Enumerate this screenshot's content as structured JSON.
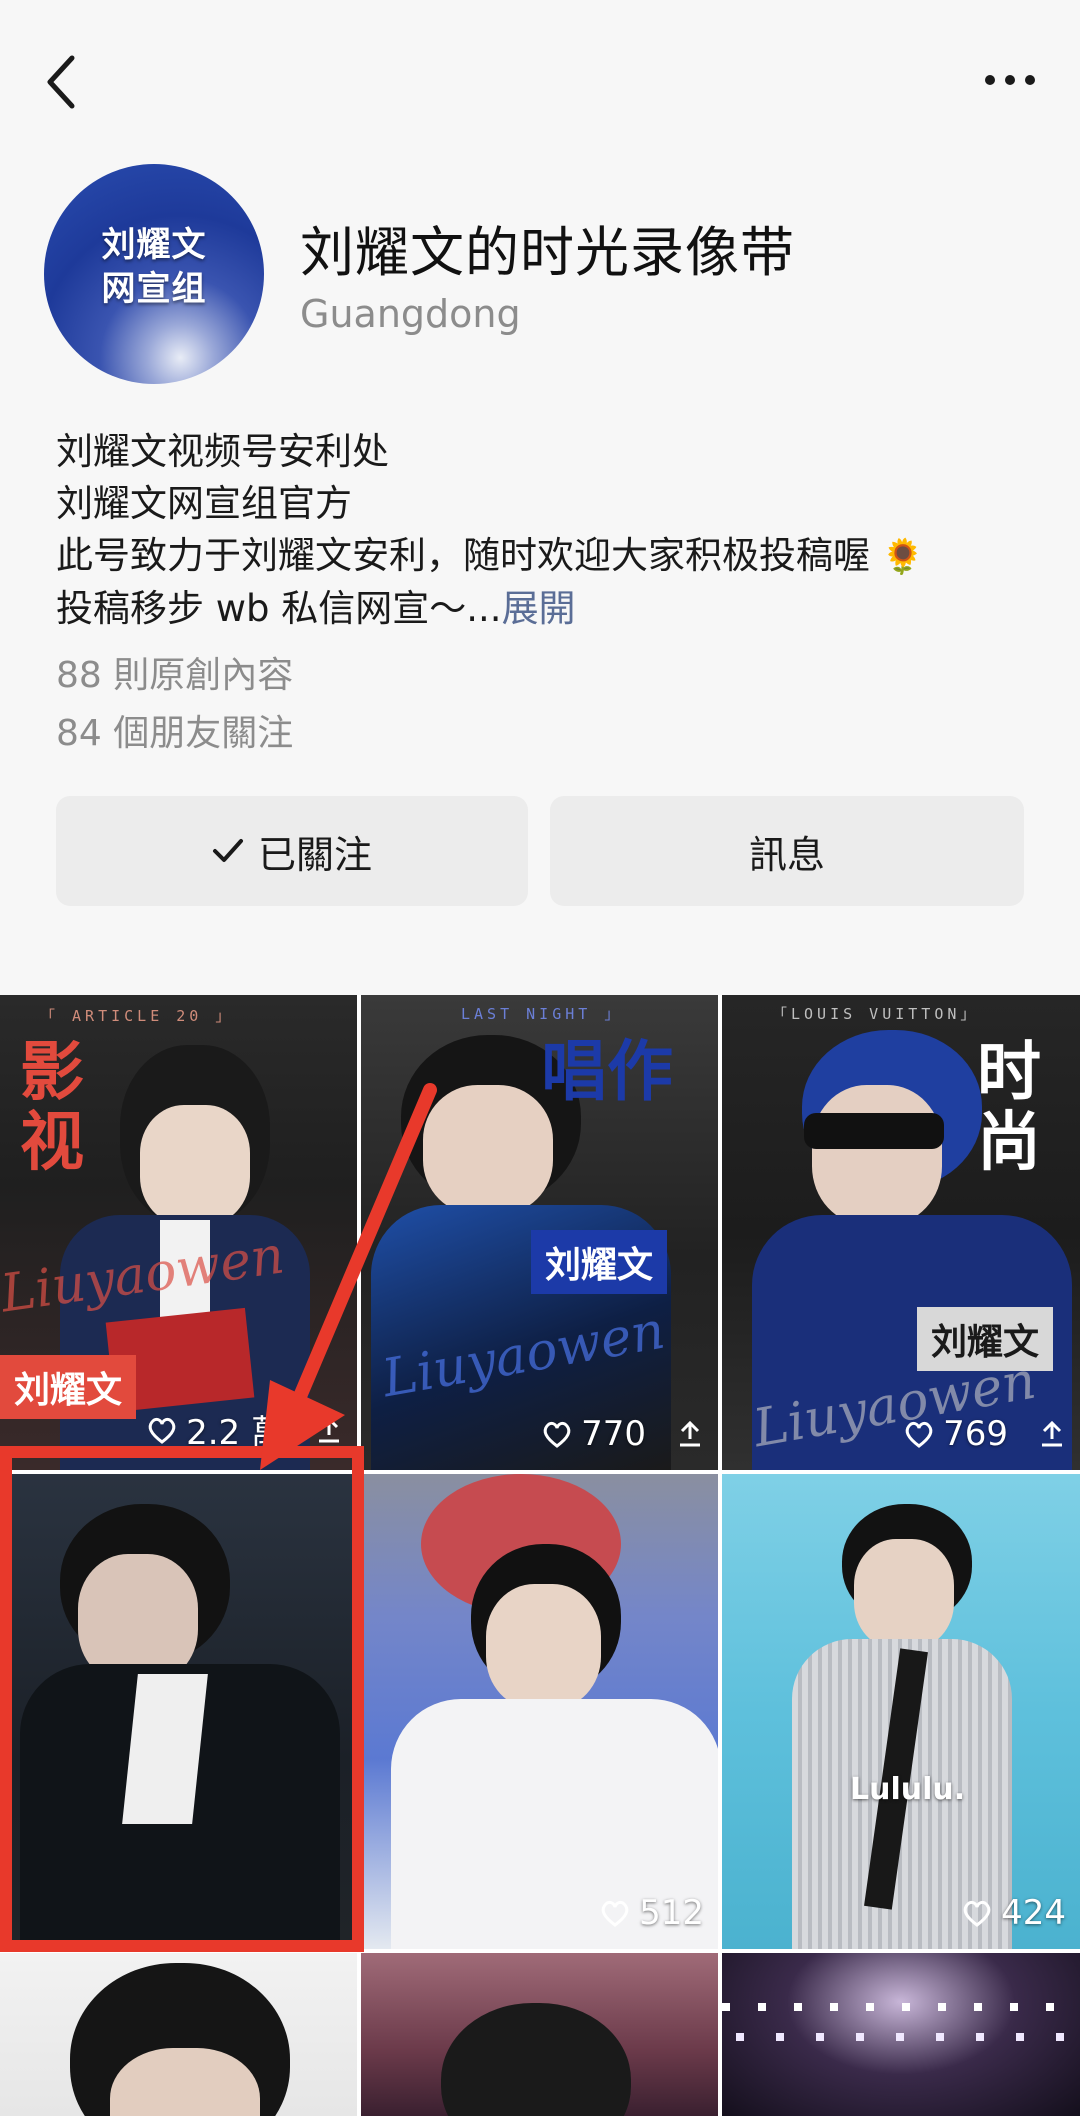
{
  "header": {
    "back_icon": "chevron-left-icon",
    "more_icon": "ellipsis-icon"
  },
  "profile": {
    "avatar_text_line1": "刘耀文",
    "avatar_text_line2": "网宣组",
    "name": "刘耀文的时光录像带",
    "location": "Guangdong",
    "bio_lines": [
      "刘耀文视频号安利处",
      "刘耀文网宣组官方",
      "此号致力于刘耀文安利，随时欢迎大家积极投稿喔"
    ],
    "bio_emoji": "🌻",
    "bio_last_line": "投稿移步 wb 私信网宣～...",
    "expand_label": "展開",
    "original_count": "88 則原創內容",
    "friends_count": "84 個朋友關注"
  },
  "actions": {
    "follow_label": "已關注",
    "message_label": "訊息"
  },
  "videos": [
    {
      "tag": "「 ARTICLE 20 」",
      "big_chars": [
        "影",
        "视"
      ],
      "name_tag": "刘耀文",
      "script": "Liuyaowen",
      "likes": "2.2 萬",
      "has_share": true
    },
    {
      "tag": "LAST NIGHT 」",
      "big_chars": [
        "唱作"
      ],
      "name_tag": "刘耀文",
      "script": "Liuyaowen",
      "likes": "770",
      "has_share": true
    },
    {
      "tag": "「LOUIS VUITTON」",
      "big_chars": [
        "时",
        "尚"
      ],
      "name_tag": "刘耀文",
      "script": "Liuyaowen",
      "likes": "769",
      "has_share": true
    },
    {
      "likes": ""
    },
    {
      "likes": "512"
    },
    {
      "likes": "424",
      "caption": "Lululu."
    }
  ],
  "colors": {
    "highlight": "#e8392b",
    "link": "#5a6d96",
    "muted": "#8c8c8c"
  }
}
